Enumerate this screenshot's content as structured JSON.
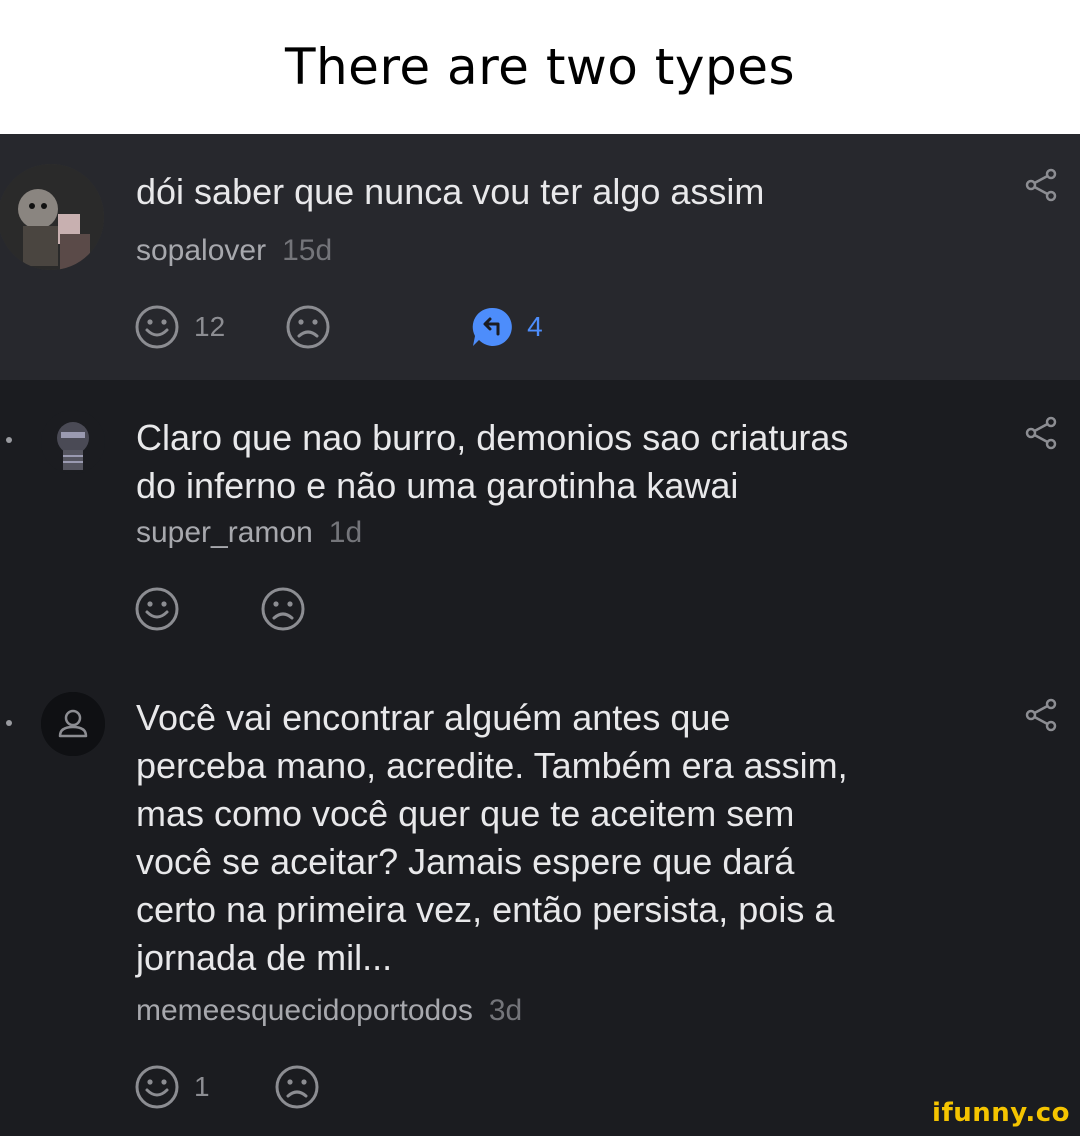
{
  "caption": "There are two types",
  "comments": [
    {
      "text": "dói saber que nunca vou ter algo assim",
      "username": "sopalover",
      "time": "15d",
      "likes": "12",
      "replies": "4"
    },
    {
      "text": "Claro que nao burro, demonios sao criaturas\ndo inferno e não uma garotinha kawai",
      "username": "super_ramon",
      "time": "1d"
    },
    {
      "text": "Você vai encontrar alguém antes que\nperceba mano, acredite. Também era assim,\nmas como você quer que te aceitem sem\nvocê se aceitar? Jamais espere que dará\ncerto na primeira vez, então persista, pois a\njornada de mil...",
      "username": "memeesquecidoportodos",
      "time": "3d",
      "likes": "1"
    }
  ],
  "watermark": "ifunny.co",
  "colors": {
    "reply_accent": "#4d8dfb",
    "watermark": "#f5c400"
  }
}
